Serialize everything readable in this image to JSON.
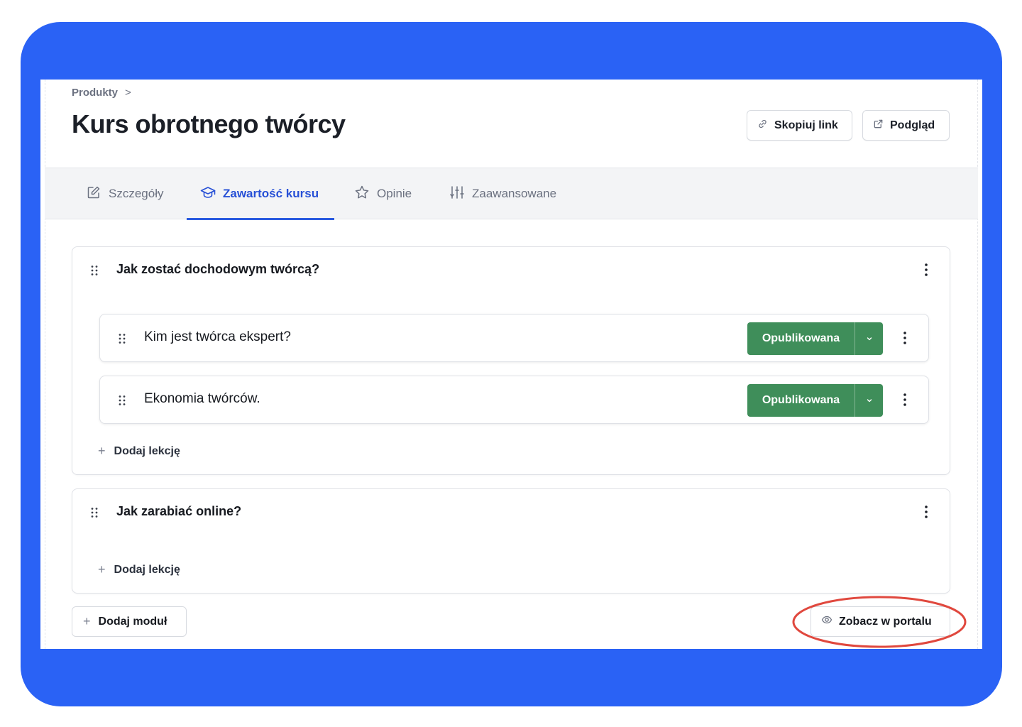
{
  "breadcrumb": {
    "parent": "Produkty",
    "separator": ">"
  },
  "page": {
    "title": "Kurs obrotnego twórcy"
  },
  "header_actions": {
    "copy_link": "Skopiuj link",
    "preview": "Podgląd"
  },
  "tabs": [
    {
      "label": "Szczegóły",
      "icon": "edit-square-icon",
      "active": false
    },
    {
      "label": "Zawartość kursu",
      "icon": "graduation-cap-icon",
      "active": true
    },
    {
      "label": "Opinie",
      "icon": "star-icon",
      "active": false
    },
    {
      "label": "Zaawansowane",
      "icon": "sliders-icon",
      "active": false
    }
  ],
  "modules": [
    {
      "title": "Jak zostać dochodowym twórcą?",
      "lessons": [
        {
          "title": "Kim jest twórca ekspert?",
          "status": "Opublikowana"
        },
        {
          "title": "Ekonomia twórców.",
          "status": "Opublikowana"
        }
      ],
      "add_lesson": "Dodaj lekcję"
    },
    {
      "title": "Jak zarabiać online?",
      "lessons": [],
      "add_lesson": "Dodaj lekcję"
    }
  ],
  "footer": {
    "add_module": "Dodaj moduł",
    "view_in_portal": "Zobacz w portalu"
  },
  "colors": {
    "frame": "#2a62f5",
    "accent": "#2a5be0",
    "published": "#3f8e5a",
    "highlight": "#e0483e"
  }
}
